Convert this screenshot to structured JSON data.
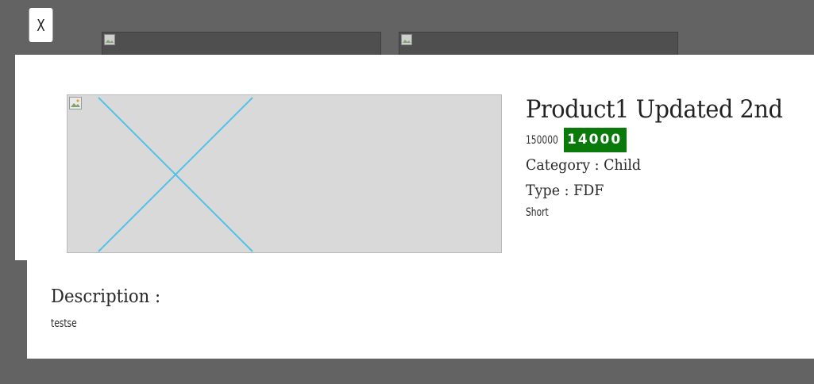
{
  "modal": {
    "close_label": "X"
  },
  "product": {
    "title": "Product1 Updated 2nd",
    "price_original": "150000",
    "price_sale": "14000",
    "category": "Category : Child",
    "type": "Type : FDF",
    "short_description": "Short",
    "description_heading": "Description :",
    "description_text": "testse"
  },
  "colors": {
    "overlay": "#636363",
    "sale_badge": "#0a7a0a",
    "image_placeholder": "#d9d9d9",
    "placeholder_cross": "#4fc3e6"
  },
  "icons": {
    "broken_image": "broken-image-icon",
    "placeholder_cross": "image-placeholder-cross"
  }
}
